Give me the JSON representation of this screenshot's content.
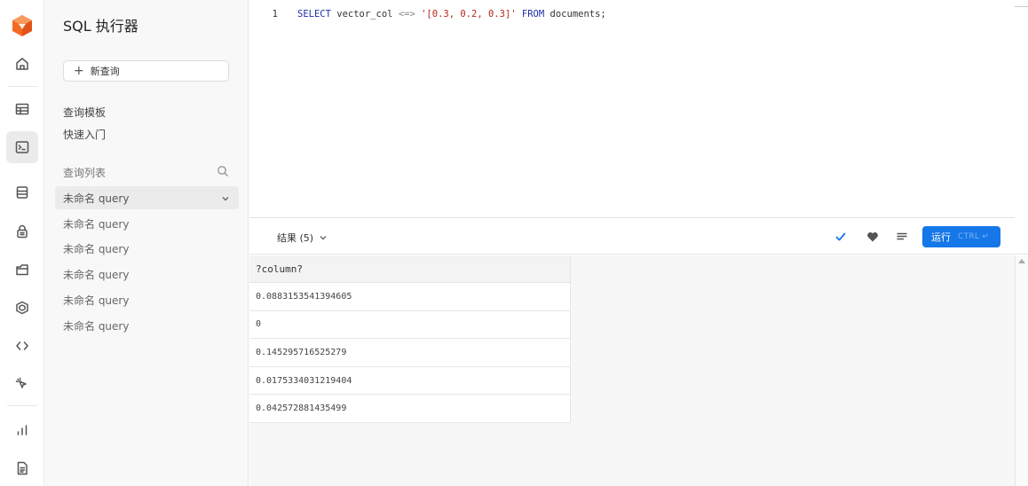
{
  "rail": {
    "icons": [
      "home-icon",
      "table-icon",
      "terminal-icon",
      "database-icon",
      "lock-icon",
      "storage-icon",
      "hexagon-icon",
      "code-icon",
      "cursor-icon",
      "chart-icon",
      "document-icon"
    ],
    "active": "terminal-icon",
    "logo_color": "#f26b25"
  },
  "sidebar": {
    "title": "SQL 执行器",
    "new_query_label": "新查询",
    "links": [
      "查询模板",
      "快速入门"
    ],
    "section_label": "查询列表",
    "queries": [
      "未命名 query",
      "未命名 query",
      "未命名 query",
      "未命名 query",
      "未命名 query",
      "未命名 query"
    ]
  },
  "editor": {
    "line_number": "1",
    "code": {
      "kw1": "SELECT",
      "ident1": "vector_col",
      "op": "<=>",
      "str": "'[0.3, 0.2, 0.3]'",
      "kw2": "FROM",
      "ident2": "documents;"
    }
  },
  "toolbar": {
    "results_label": "结果 (5)",
    "run_label": "运行",
    "run_hint": "CTRL ↵",
    "accent": "#1677e8"
  },
  "results": {
    "column": "?column?",
    "rows": [
      "0.0883153541394605",
      "0",
      "0.145295716525279",
      "0.0175334031219404",
      "0.042572881435499"
    ]
  }
}
